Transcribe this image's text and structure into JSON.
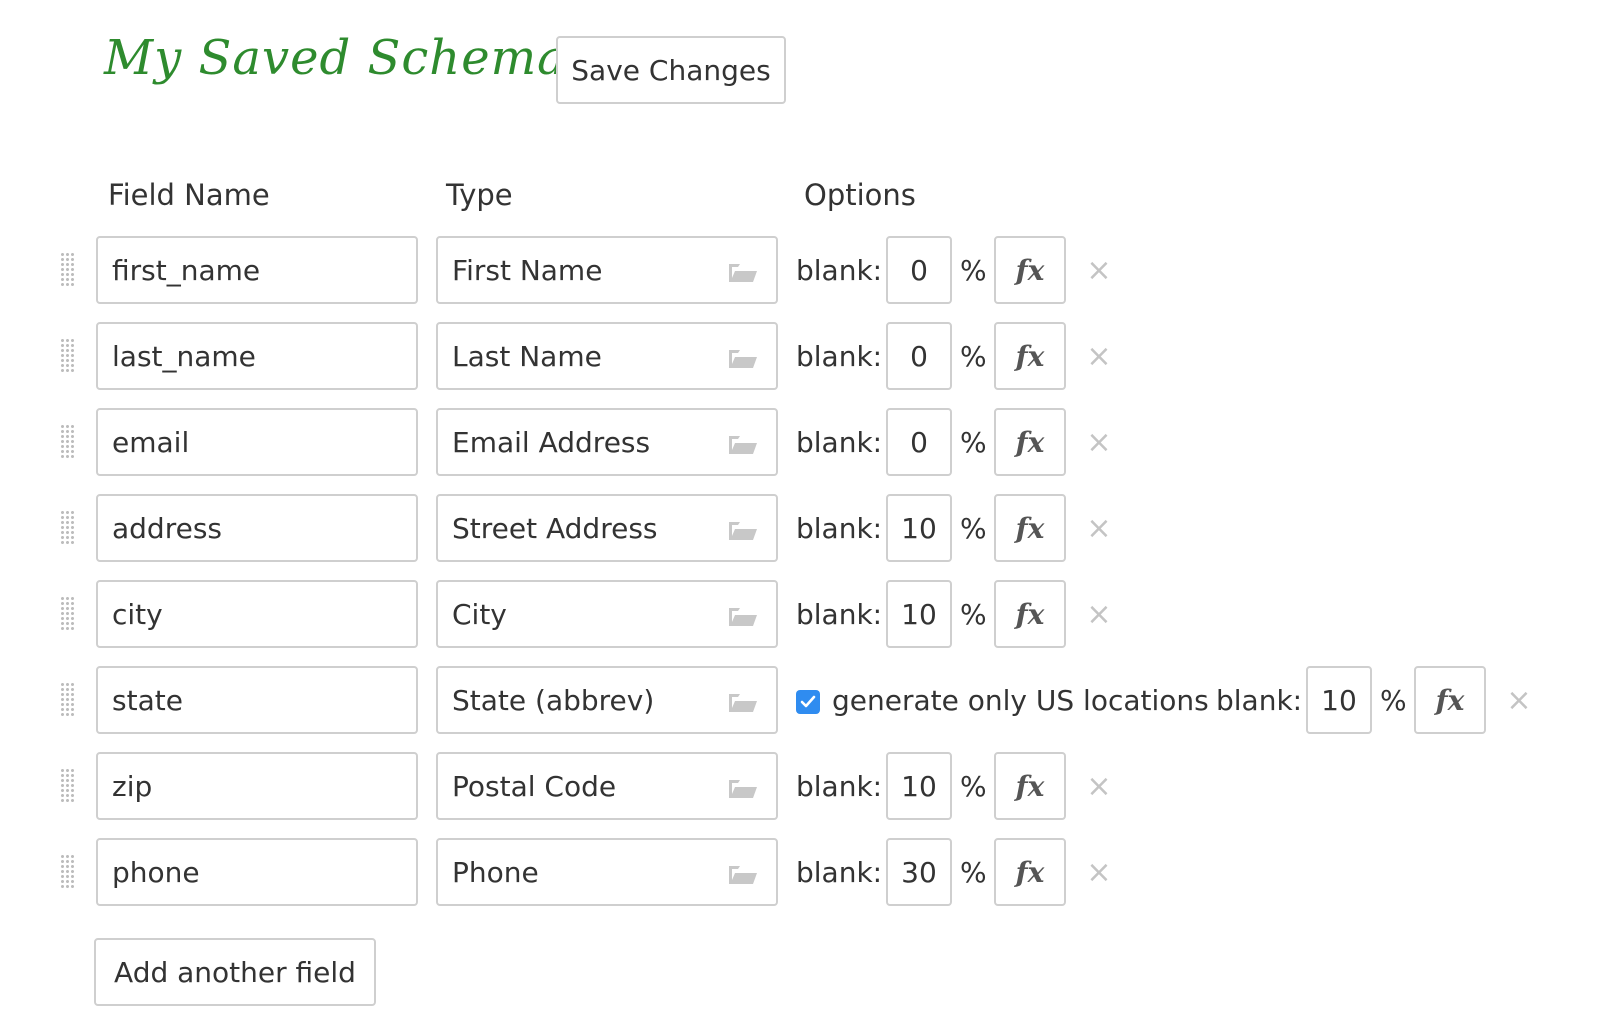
{
  "title": "My Saved Schema",
  "save_button": "Save Changes",
  "add_button": "Add another field",
  "headers": {
    "field_name": "Field Name",
    "type": "Type",
    "options": "Options"
  },
  "blank_label": "blank:",
  "percent_label": "%",
  "fx_label": "fx",
  "remove_label": "×",
  "fields": [
    {
      "name": "first_name",
      "type": "First Name",
      "blank": "0"
    },
    {
      "name": "last_name",
      "type": "Last Name",
      "blank": "0"
    },
    {
      "name": "email",
      "type": "Email Address",
      "blank": "0"
    },
    {
      "name": "address",
      "type": "Street Address",
      "blank": "10"
    },
    {
      "name": "city",
      "type": "City",
      "blank": "10"
    },
    {
      "name": "state",
      "type": "State (abbrev)",
      "blank": "10",
      "checkbox_label": "generate only US locations",
      "checkbox_checked": true
    },
    {
      "name": "zip",
      "type": "Postal Code",
      "blank": "10"
    },
    {
      "name": "phone",
      "type": "Phone",
      "blank": "30"
    }
  ],
  "colors": {
    "title": "#2e8b2e",
    "checkbox": "#2f8cf0",
    "border": "#cfcfcf",
    "text": "#333333"
  }
}
